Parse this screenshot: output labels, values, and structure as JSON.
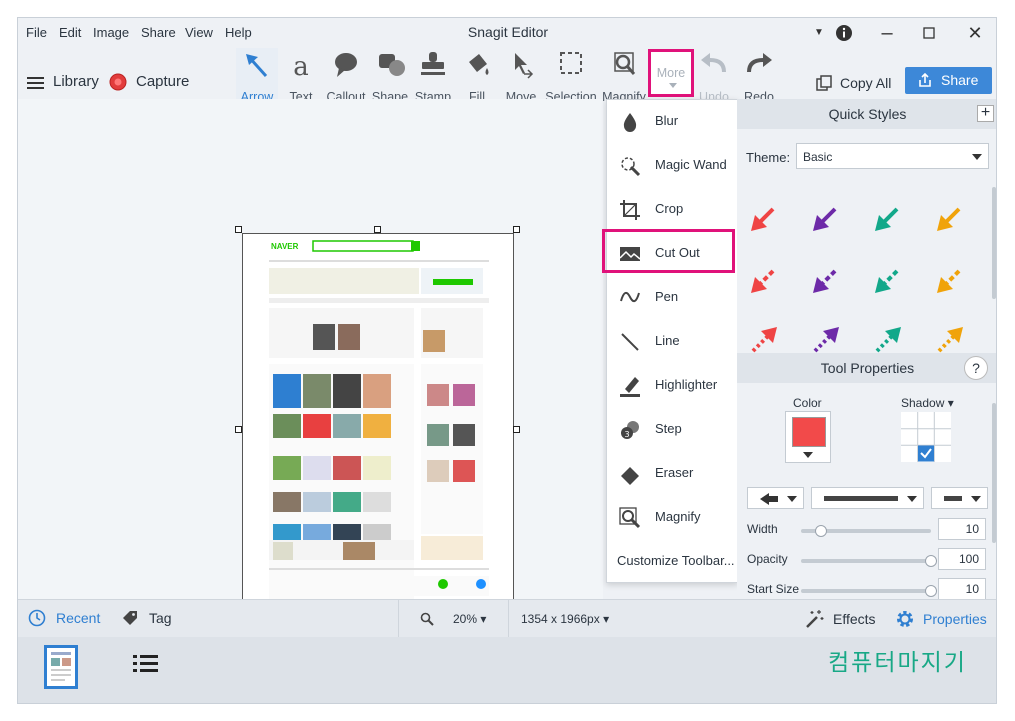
{
  "menubar": {
    "items": [
      "File",
      "Edit",
      "Image",
      "Share",
      "View",
      "Help"
    ],
    "title": "Snagit Editor"
  },
  "header": {
    "library_label": "Library",
    "capture_label": "Capture",
    "copy_all_label": "Copy All",
    "share_label": "Share"
  },
  "toolbar": {
    "tools": [
      {
        "label": "Arrow",
        "icon": "arrow-icon"
      },
      {
        "label": "Text",
        "icon": "text-icon"
      },
      {
        "label": "Callout",
        "icon": "callout-icon"
      },
      {
        "label": "Shape",
        "icon": "shape-icon"
      },
      {
        "label": "Stamp",
        "icon": "stamp-icon"
      },
      {
        "label": "Fill",
        "icon": "fill-icon"
      },
      {
        "label": "Move",
        "icon": "move-icon"
      },
      {
        "label": "Selection",
        "icon": "selection-icon"
      },
      {
        "label": "Magnify",
        "icon": "magnify-icon"
      },
      {
        "label": "More",
        "icon": "more-icon"
      },
      {
        "label": "Undo",
        "icon": "undo-icon"
      },
      {
        "label": "Redo",
        "icon": "redo-icon"
      }
    ]
  },
  "more_menu": {
    "items": [
      "Blur",
      "Magic Wand",
      "Crop",
      "Cut Out",
      "Pen",
      "Line",
      "Highlighter",
      "Step",
      "Eraser",
      "Magnify"
    ],
    "customize_label": "Customize Toolbar..."
  },
  "quick_styles": {
    "title": "Quick Styles",
    "theme_label": "Theme:",
    "theme_value": "Basic",
    "arrow_colors": [
      "#ef4444",
      "#6d2aa8",
      "#12a88a",
      "#f0a30a"
    ]
  },
  "tool_properties": {
    "title": "Tool Properties",
    "help": "?",
    "color_label": "Color",
    "shadow_label": "Shadow",
    "color_value": "#f24a4a",
    "width_label": "Width",
    "width_value": "10",
    "width_fraction": 0.15,
    "opacity_label": "Opacity",
    "opacity_value": "100",
    "opacity_fraction": 1.0,
    "start_size_label": "Start Size",
    "start_size_value": "10",
    "start_size_fraction": 1.0
  },
  "statusbar": {
    "recent_label": "Recent",
    "tag_label": "Tag",
    "zoom_value": "20%",
    "dimensions": "1354 x 1966px",
    "effects_label": "Effects",
    "properties_label": "Properties"
  },
  "watermark": "컴퓨터마지기",
  "colors": {
    "accent": "#2f7fd1",
    "highlight_box": "#e0127a"
  }
}
